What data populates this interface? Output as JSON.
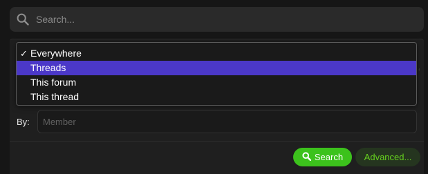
{
  "search": {
    "placeholder": "Search..."
  },
  "scope_menu": {
    "options": [
      {
        "label": "Everywhere",
        "checked": true,
        "highlighted": false
      },
      {
        "label": "Threads",
        "checked": false,
        "highlighted": true
      },
      {
        "label": "This forum",
        "checked": false,
        "highlighted": false
      },
      {
        "label": "This thread",
        "checked": false,
        "highlighted": false
      }
    ],
    "check_glyph": "✓"
  },
  "by_filter": {
    "label": "By:",
    "placeholder": "Member"
  },
  "actions": {
    "search_label": "Search",
    "advanced_label": "Advanced..."
  },
  "colors": {
    "highlight": "#4b38c8",
    "search_button": "#3cc21c",
    "advanced_text": "#66d11f"
  }
}
